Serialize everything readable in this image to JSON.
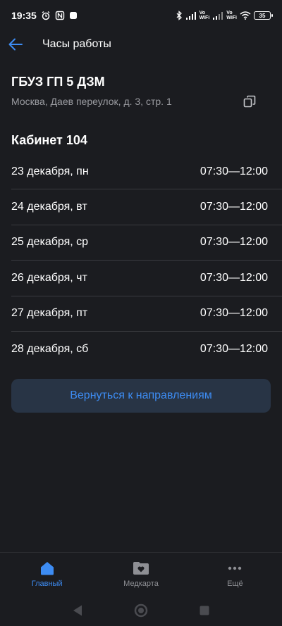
{
  "status_bar": {
    "time": "19:35",
    "battery": "35",
    "vowifi_1": "Vo\nWiFi",
    "vowifi_2": "Vo\nWiFi"
  },
  "app_bar": {
    "title": "Часы работы"
  },
  "organization": {
    "name": "ГБУЗ ГП 5 ДЗМ",
    "address": "Москва, Даев переулок, д. 3, стр. 1"
  },
  "cabinet": {
    "title": "Кабинет 104"
  },
  "schedule": [
    {
      "day": "23 декабря, пн",
      "time": "07:30—12:00"
    },
    {
      "day": "24 декабря, вт",
      "time": "07:30—12:00"
    },
    {
      "day": "25 декабря, ср",
      "time": "07:30—12:00"
    },
    {
      "day": "26 декабря, чт",
      "time": "07:30—12:00"
    },
    {
      "day": "27 декабря, пт",
      "time": "07:30—12:00"
    },
    {
      "day": "28 декабря, сб",
      "time": "07:30—12:00"
    }
  ],
  "actions": {
    "return_label": "Вернуться к направлениям"
  },
  "bottom_nav": {
    "items": [
      {
        "label": "Главный",
        "icon": "home-icon",
        "active": true
      },
      {
        "label": "Медкарта",
        "icon": "medcard-icon",
        "active": false
      },
      {
        "label": "Ещё",
        "icon": "more-icon",
        "active": false
      }
    ]
  },
  "colors": {
    "background": "#1b1c20",
    "accent": "#3d8cf3",
    "button_bg": "#283445",
    "secondary_text": "#9a9ba0",
    "divider": "#3a3b40"
  }
}
